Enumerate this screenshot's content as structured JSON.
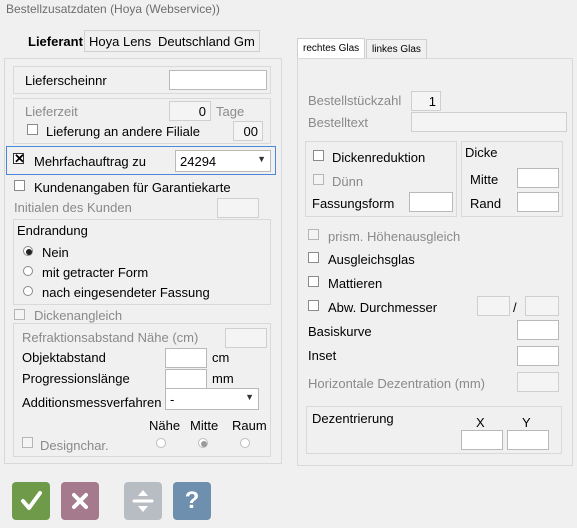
{
  "window": {
    "title": "Bestellzusatzdaten (Hoya (Webservice))"
  },
  "left_tabs": [
    "Lieferant",
    "Hoya Lens",
    "Deutschland Gm"
  ],
  "left": {
    "lieferscheinnr": {
      "label": "Lieferscheinnr",
      "value": ""
    },
    "lieferzeit": {
      "label": "Lieferzeit",
      "value": "0",
      "unit": "Tage"
    },
    "andere_filiale": {
      "label": "Lieferung an andere Filiale",
      "value": "00"
    },
    "mehrfach": {
      "label": "Mehrfachauftrag zu",
      "value": "24294",
      "checked": true
    },
    "kundenangaben": {
      "label": "Kundenangaben für Garantiekarte"
    },
    "initialen": {
      "label": "Initialen des Kunden",
      "value": ""
    },
    "endrandung": {
      "label": "Endrandung",
      "options": [
        "Nein",
        "mit getracter Form",
        "nach eingesendeter Fassung"
      ],
      "selected": "Nein"
    },
    "dickenangleich": {
      "label": "Dickenangleich"
    },
    "refraktionsabstand": {
      "label": "Refraktionsabstand Nähe (cm)",
      "value": ""
    },
    "objektabstand": {
      "label": "Objektabstand",
      "value": "",
      "unit": "cm"
    },
    "progressionslaenge": {
      "label": "Progressionslänge",
      "value": "",
      "unit": "mm"
    },
    "additionsmess": {
      "label": "Additionsmessverfahren",
      "value": "-"
    },
    "designchar": {
      "label": "Designchar.",
      "cols": [
        "Nähe",
        "Mitte",
        "Raum"
      ],
      "selected": "Mitte"
    }
  },
  "right_tabs": [
    "rechtes Glas",
    "linkes Glas"
  ],
  "right": {
    "bestellstueckzahl": {
      "label": "Bestellstückzahl",
      "value": "1"
    },
    "bestelltext": {
      "label": "Bestelltext",
      "value": ""
    },
    "dickenreduktion": {
      "label": "Dickenreduktion"
    },
    "duenn": {
      "label": "Dünn"
    },
    "fassungsform": {
      "label": "Fassungsform",
      "value": ""
    },
    "dicke": {
      "label": "Dicke",
      "mitte": "Mitte",
      "rand": "Rand"
    },
    "prism": {
      "label": "prism. Höhenausgleich"
    },
    "ausgleichsglas": {
      "label": "Ausgleichsglas"
    },
    "mattieren": {
      "label": "Mattieren"
    },
    "abw_durchmesser": {
      "label": "Abw. Durchmesser",
      "sep": "/"
    },
    "basiskurve": {
      "label": "Basiskurve"
    },
    "inset": {
      "label": "Inset"
    },
    "hor_dez": {
      "label": "Horizontale Dezentration (mm)"
    },
    "dezentrierung": {
      "label": "Dezentrierung",
      "x": "X",
      "y": "Y"
    }
  },
  "buttons": {
    "ok": {
      "icon": "check-icon",
      "color": "#6e9a4a"
    },
    "cancel": {
      "icon": "x-icon",
      "color": "#a47a8c"
    },
    "divide": {
      "icon": "divide-icon",
      "color": "#b8bdc4"
    },
    "help": {
      "icon": "help-icon",
      "color": "#6f8fae"
    }
  }
}
